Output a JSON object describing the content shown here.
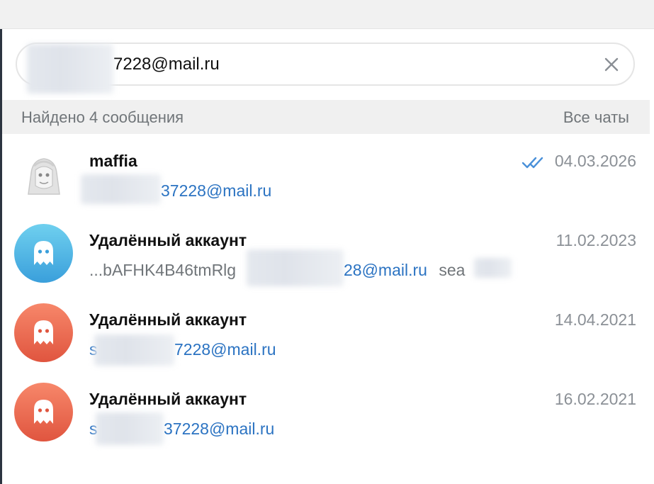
{
  "search": {
    "value": "7228@mail.ru"
  },
  "results": {
    "found_label": "Найдено 4 сообщения",
    "all_chats_label": "Все чаты"
  },
  "messages": [
    {
      "name": "maffia",
      "date": "04.03.2026",
      "status": "read",
      "preview_prefix": "",
      "link_suffix": "37228@mail.ru",
      "preview_suffix": "",
      "avatar": "photo"
    },
    {
      "name": "Удалённый аккаунт",
      "date": "11.02.2023",
      "preview_prefix": "...bAFHK4B46tmRlg",
      "link_suffix": "28@mail.ru",
      "preview_suffix": "sea",
      "avatar": "ghost-icon",
      "avatar_color": "#3a9fdb"
    },
    {
      "name": "Удалённый аккаунт",
      "date": "14.04.2021",
      "preview_prefix": "s",
      "link_suffix": "7228@mail.ru",
      "preview_suffix": "",
      "avatar": "ghost-icon",
      "avatar_color": "#e0553f"
    },
    {
      "name": "Удалённый аккаунт",
      "date": "16.02.2021",
      "preview_prefix": "s",
      "link_suffix": "37228@mail.ru",
      "preview_suffix": "",
      "avatar": "ghost-icon",
      "avatar_color": "#e0553f"
    }
  ],
  "colors": {
    "link": "#2b73c2",
    "muted": "#707579",
    "check": "#4a90d9"
  }
}
